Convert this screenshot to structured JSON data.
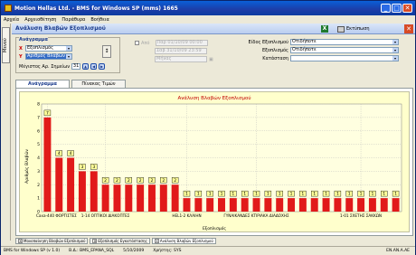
{
  "window": {
    "title": "Motion Hellas Ltd. - BMS for Windows SP (mms) 1665",
    "controls": {
      "minimize": "_",
      "maximize": "□",
      "close": "✕"
    }
  },
  "menu": [
    "Αρχεία",
    "Αρχειοθέτηση",
    "Παράθυρα",
    "Βοήθεια"
  ],
  "left_strip": {
    "label": "Μενού"
  },
  "header": {
    "title": "Ανάλυση Βλαβών Εξοπλισμού",
    "print_label": "Εκτύπωση",
    "excel_glyph": "X",
    "close_glyph": "✕"
  },
  "filters": {
    "group_title": "Ανάγραμμα",
    "x_axis_label": "X",
    "x_axis_value": "Εξοπλισμός",
    "y_axis_label": "Y",
    "y_axis_value": "Αριθμός Βλαβών",
    "max_records_label": "Μέγιστος Αρ. Σημείων",
    "max_records_value": "31",
    "date_check_label": "Από",
    "date_from": "Παρ 01/10/09 00:00",
    "date_to": "Σαβ 31/10/09 23:59",
    "month_value": "Μήνας",
    "equipment_type_label": "Είδος Εξοπλισμού",
    "equipment_type_value": "Οτιδήποτε",
    "equipment_label": "Εξοπλισμός",
    "equipment_value": "Οτιδήποτε",
    "building_label": "Κατάσταση",
    "building_value": ""
  },
  "tabs": [
    {
      "label": "Ανάγραμμα",
      "active": true
    },
    {
      "label": "Πίνακας Τιμών",
      "active": false
    }
  ],
  "chart_data": {
    "type": "bar",
    "title": "Ανάλυση Βλαβών Εξοπλισμού",
    "xlabel": "Εξοπλισμός",
    "ylabel": "Αριθμός Βλαβών",
    "ylim": [
      0,
      8
    ],
    "yticks": [
      0,
      1,
      2,
      3,
      4,
      5,
      6,
      7,
      8
    ],
    "values": [
      7,
      4,
      4,
      3,
      3,
      2,
      2,
      2,
      2,
      2,
      2,
      2,
      1,
      1,
      1,
      1,
      1,
      1,
      1,
      1,
      1,
      1,
      1,
      1,
      1,
      1,
      1,
      1,
      1,
      1,
      1
    ],
    "x_tick_labels": [
      {
        "index": 0,
        "text": "Caxa-440 ΦΟΡΤΙΣΤΕΣ"
      },
      {
        "index": 5,
        "text": "1-14 ΟΠΤΙΚΟΙ ΔΙΑΚΟΠΤΕΣ"
      },
      {
        "index": 12,
        "text": "HEL1-2 ΚΛΑΙΗΝ"
      },
      {
        "index": 18,
        "text": "ΓΥΝΑΙΚΑΝΔΕΣ ΚΤΙΡΙΑΚΑ ΔΙΑΔΟΧΗΣ"
      },
      {
        "index": 27,
        "text": "1-01 ΣΧΕΤΗΣ ΣΑΚΚΩΝ"
      }
    ],
    "bar_color": "#e11a1a",
    "grid": true,
    "data_labels": true
  },
  "bottom_tabs": [
    "Μονοπαίνηση Βλαβών Εξοπλισμού",
    "Εξοπλισμός Εγκατάστασης",
    "Ανάλυση Βλαβών Εξοπλισμού"
  ],
  "status": {
    "app": "BMS for Windows SP (v 1.0)",
    "db": "Β.Δ.: BMS_EPANA_SQL",
    "date": "5/10/2009",
    "user": "Χρήστης: SYS",
    "lang": "EN.AN.A.AE"
  }
}
